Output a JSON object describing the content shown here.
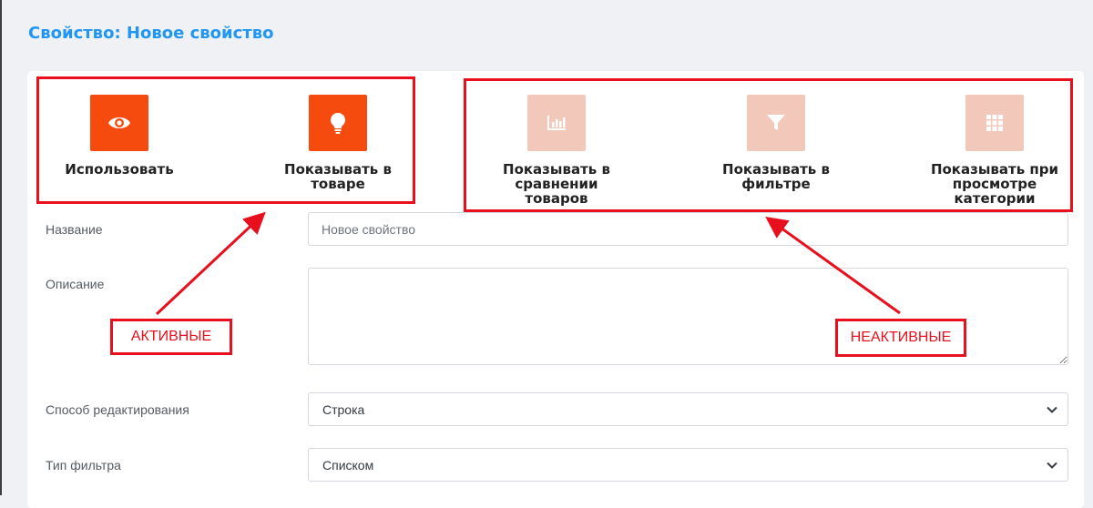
{
  "page": {
    "title": "Свойство: Новое свойство"
  },
  "toggles": [
    {
      "label": "Использовать",
      "icon": "eye-icon",
      "state": "active"
    },
    {
      "label": "Показывать в\nтоваре",
      "icon": "lightbulb-icon",
      "state": "active"
    },
    {
      "label": "Показывать в\nсравнении\nтоваров",
      "icon": "bar-chart-icon",
      "state": "inactive"
    },
    {
      "label": "Показывать в\nфильтре",
      "icon": "filter-icon",
      "state": "inactive"
    },
    {
      "label": "Показывать при\nпросмотре\nкатегории",
      "icon": "grid-icon",
      "state": "inactive"
    }
  ],
  "annotations": {
    "active_label": "АКТИВНЫЕ",
    "inactive_label": "НЕАКТИВНЫЕ"
  },
  "form": {
    "name_label": "Название",
    "name_placeholder": "Новое свойство",
    "description_label": "Описание",
    "edit_mode_label": "Способ редактирования",
    "edit_mode_value": "Строка",
    "filter_type_label": "Тип фильтра",
    "filter_type_value": "Списком"
  },
  "colors": {
    "title": "#2196f3",
    "active_tile": "#f54b0f",
    "inactive_tile": "#f2c8bb",
    "annotation_red": "#e8101c"
  }
}
